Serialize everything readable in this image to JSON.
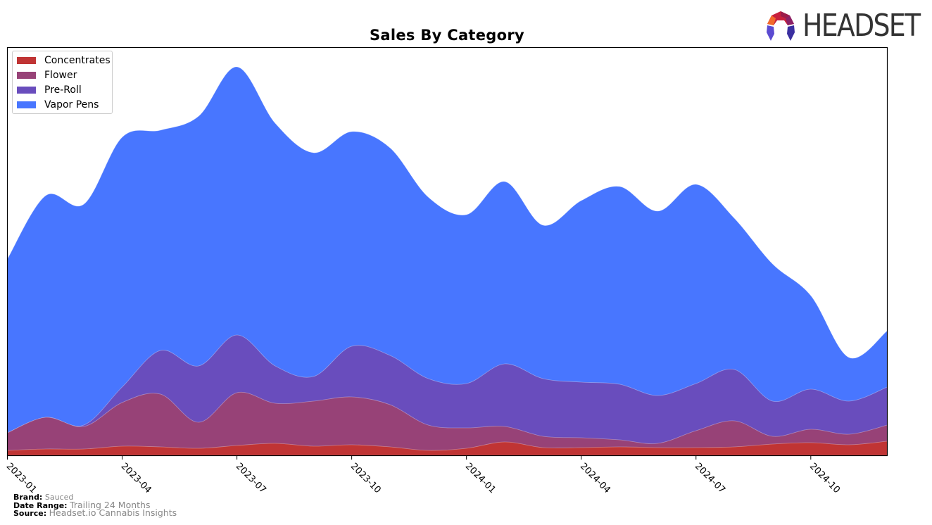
{
  "header": {
    "logo_text": "HEADSET"
  },
  "footer": {
    "brand_label": "Brand:",
    "brand_value": "Sauced",
    "date_range_label": "Date Range:",
    "date_range_value": "Trailing 24 Months",
    "source_label": "Source:",
    "source_value": "Headset.io Cannabis Insights"
  },
  "colors": {
    "Concentrates": "#c03434",
    "Flower": "#974277",
    "Pre-Roll": "#694dbd",
    "Vapor Pens": "#4876ff"
  },
  "chart_data": {
    "type": "area",
    "stacked": true,
    "title": "Sales By Category",
    "xlabel": "",
    "ylabel": "",
    "y_axis_visible": false,
    "grid": false,
    "legend_position": "top-left",
    "x": [
      "2023-01",
      "2023-02",
      "2023-03",
      "2023-04",
      "2023-05",
      "2023-06",
      "2023-07",
      "2023-08",
      "2023-09",
      "2023-10",
      "2023-11",
      "2023-12",
      "2024-01",
      "2024-02",
      "2024-03",
      "2024-04",
      "2024-05",
      "2024-06",
      "2024-07",
      "2024-08",
      "2024-09",
      "2024-10",
      "2024-11",
      "2024-12"
    ],
    "x_tick_labels": [
      "2023-01",
      "2023-04",
      "2023-07",
      "2023-10",
      "2024-01",
      "2024-04",
      "2024-07",
      "2024-10"
    ],
    "series": [
      {
        "name": "Concentrates",
        "values": [
          7,
          9,
          9,
          13,
          12,
          10,
          14,
          17,
          13,
          15,
          12,
          7,
          10,
          19,
          11,
          11,
          12,
          11,
          11,
          12,
          16,
          18,
          15,
          20
        ]
      },
      {
        "name": "Flower",
        "values": [
          25,
          45,
          32,
          62,
          75,
          37,
          75,
          57,
          64,
          68,
          60,
          36,
          29,
          22,
          16,
          14,
          10,
          6,
          24,
          37,
          11,
          19,
          15,
          23
        ]
      },
      {
        "name": "Pre-Roll",
        "values": [
          0,
          0,
          2,
          22,
          62,
          80,
          82,
          53,
          35,
          72,
          70,
          66,
          63,
          89,
          82,
          79,
          79,
          68,
          67,
          73,
          50,
          57,
          47,
          54
        ]
      },
      {
        "name": "Vapor Pens",
        "values": [
          247,
          315,
          314,
          355,
          313,
          355,
          381,
          345,
          318,
          305,
          295,
          258,
          240,
          259,
          218,
          258,
          281,
          262,
          283,
          215,
          195,
          133,
          62,
          80
        ]
      }
    ],
    "units": "relative (no y-axis shown)"
  }
}
